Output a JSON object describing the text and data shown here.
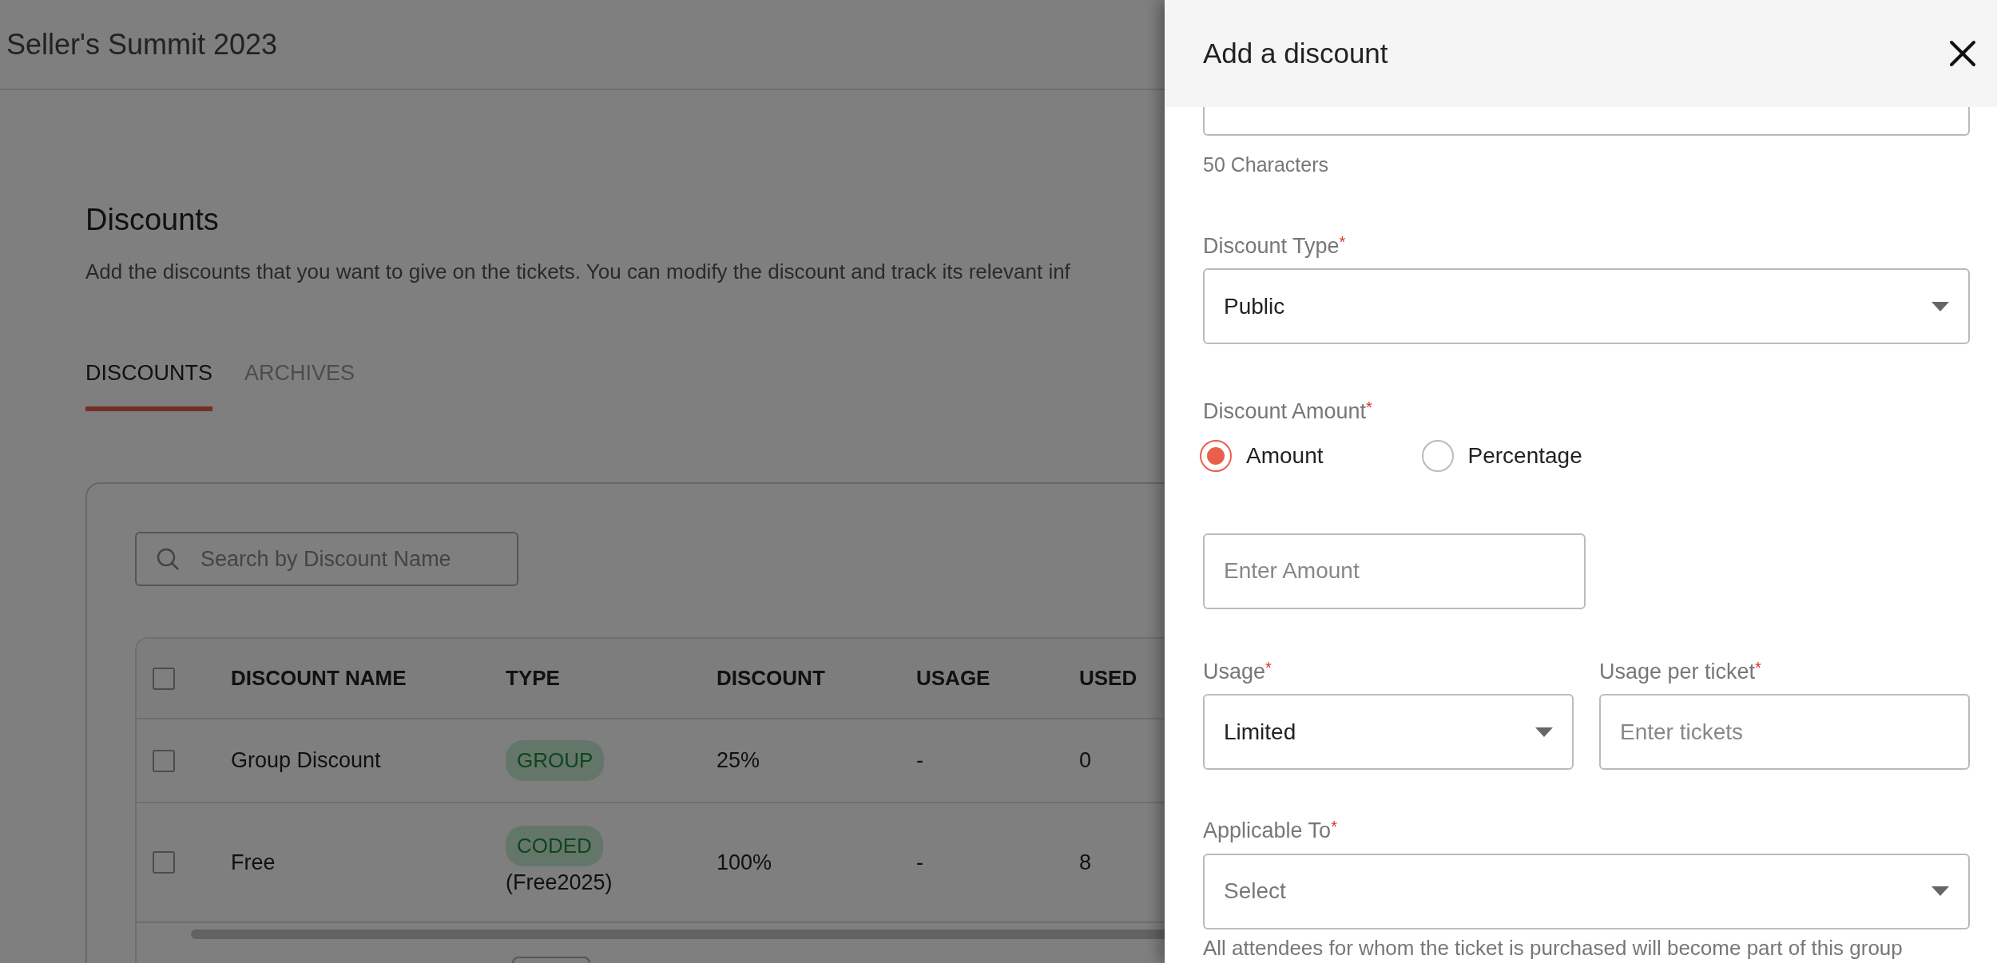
{
  "top_bar": {
    "title": "Seller's Summit 2023"
  },
  "page": {
    "title": "Discounts",
    "description": "Add the discounts that you want to give on the tickets. You can modify the discount and track its relevant inf"
  },
  "tabs": [
    {
      "label": "DISCOUNTS",
      "selected": true
    },
    {
      "label": "ARCHIVES",
      "selected": false
    }
  ],
  "search": {
    "placeholder": "Search by Discount Name"
  },
  "table": {
    "header_checked": false,
    "columns": [
      "DISCOUNT NAME",
      "TYPE",
      "DISCOUNT",
      "USAGE",
      "USED"
    ],
    "rows": [
      {
        "checked": false,
        "name": "Group Discount",
        "type": "GROUP",
        "code": "",
        "discount": "25%",
        "usage": "-",
        "used": "0"
      },
      {
        "checked": false,
        "name": "Free",
        "type": "CODED",
        "code": "(Free2025)",
        "discount": "100%",
        "usage": "-",
        "used": "8"
      }
    ]
  },
  "drawer": {
    "title": "Add a discount",
    "name_hint": "50 Characters",
    "discount_type": {
      "label": "Discount Type",
      "required_mark": "*",
      "value": "Public"
    },
    "discount_amount": {
      "label": "Discount Amount",
      "required_mark": "*",
      "options": [
        {
          "label": "Amount",
          "selected": true
        },
        {
          "label": "Percentage",
          "selected": false
        }
      ],
      "input_placeholder": "Enter Amount"
    },
    "usage": {
      "label": "Usage",
      "required_mark": "*",
      "value": "Limited"
    },
    "usage_per_ticket": {
      "label": "Usage per ticket",
      "required_mark": "*",
      "placeholder": "Enter tickets"
    },
    "applicable_to": {
      "label": "Applicable To",
      "required_mark": "*",
      "placeholder": "Select"
    },
    "help_text": "All attendees for whom the ticket is purchased will become part of this group"
  }
}
